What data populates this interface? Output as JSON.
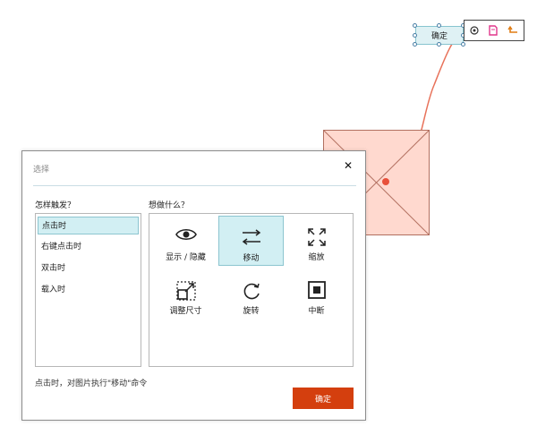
{
  "canvas": {
    "selected_widget_label": "确定",
    "connector_color": "#e8725a"
  },
  "mini_toolbar": {
    "icons": [
      "link-target-icon",
      "page-icon",
      "return-arrow-icon"
    ]
  },
  "dialog": {
    "title": "选择",
    "close_glyph": "✕",
    "trigger_section_label": "怎样触发？",
    "action_section_label": "想做什么？",
    "triggers": [
      {
        "label": "点击时",
        "active": true
      },
      {
        "label": "右键点击时",
        "active": false
      },
      {
        "label": "双击时",
        "active": false
      },
      {
        "label": "载入时",
        "active": false
      }
    ],
    "actions": [
      {
        "label": "显示 / 隐藏",
        "icon": "eye-icon",
        "active": false
      },
      {
        "label": "移动",
        "icon": "move-arrows-icon",
        "active": true
      },
      {
        "label": "缩放",
        "icon": "scale-icon",
        "active": false
      },
      {
        "label": "调整尺寸",
        "icon": "resize-icon",
        "active": false
      },
      {
        "label": "旋转",
        "icon": "rotate-icon",
        "active": false
      },
      {
        "label": "中断",
        "icon": "stop-icon",
        "active": false
      }
    ],
    "summary": "点击时，对图片执行\"移动\"命令",
    "ok_label": "确定",
    "accent_color": "#d43f0e",
    "highlight_color": "#d2eff3"
  }
}
